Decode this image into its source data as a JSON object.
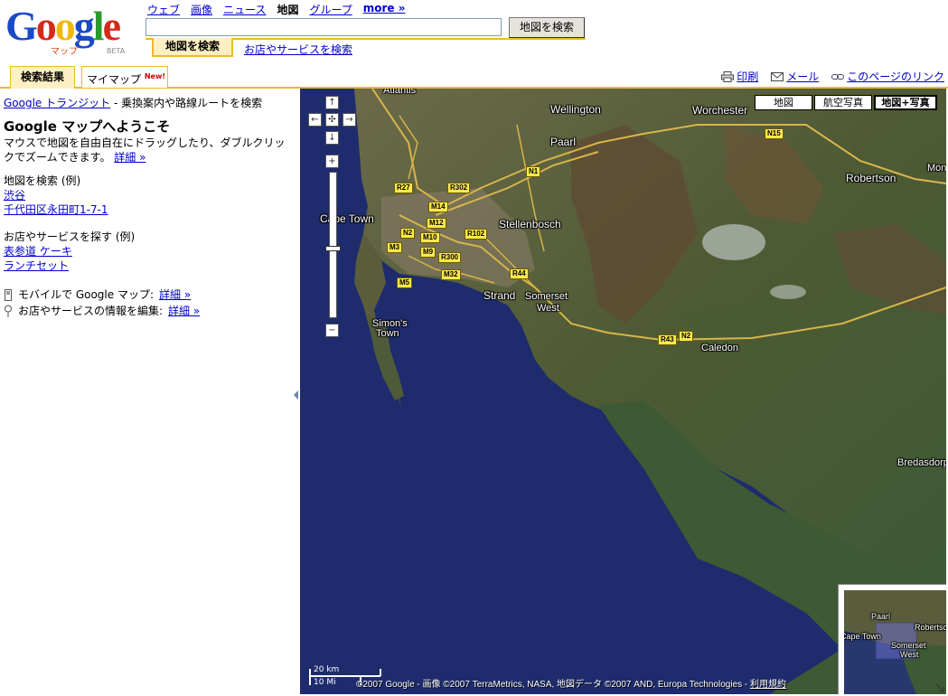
{
  "logo": {
    "text": "Google",
    "sub": "マップ",
    "beta": "BETA"
  },
  "topnav": [
    {
      "label": "ウェブ"
    },
    {
      "label": "画像"
    },
    {
      "label": "ニュース"
    },
    {
      "label": "地図",
      "selected": true
    },
    {
      "label": "グループ"
    },
    {
      "label": "more »"
    }
  ],
  "search": {
    "value": "",
    "button": "地図を検索",
    "tab_map": "地図を検索",
    "tab_business": "お店やサービスを検索"
  },
  "panel_tabs": {
    "results": "検索結果",
    "mymaps": "マイマップ",
    "new_badge": "New!"
  },
  "page_links": {
    "print": "印刷",
    "mail": "メール",
    "link": "このページのリンク"
  },
  "left": {
    "transit_link": "Google トランジット",
    "transit_text": " - 乗換案内や路線ルートを検索",
    "welcome_title": "Google マップへようこそ",
    "welcome_text": "マウスで地図を自由自在にドラッグしたり、ダブルクリックでズームできます。",
    "more_link": "詳細 »",
    "map_search_label": "地図を検索 (例)",
    "map_examples": [
      "渋谷",
      "千代田区永田町1-7-1"
    ],
    "biz_search_label": "お店やサービスを探す (例)",
    "biz_examples": [
      "表参道 ケーキ",
      "ランチセット"
    ],
    "mobile_text": "モバイルで Google マップ:",
    "mobile_link": "詳細 »",
    "edit_text": "お店やサービスの情報を編集:",
    "edit_link": "詳細 »"
  },
  "map": {
    "types": [
      "地図",
      "航空写真",
      "地図+写真"
    ],
    "selected_type": "地図+写真",
    "places": {
      "atlantis": "Atlantis",
      "wellington": "Wellington",
      "worchester": "Worchester",
      "paarl": "Paarl",
      "robertson": "Robertson",
      "mon": "Mon",
      "cape_town": "Cape Town",
      "stellenbosch": "Stellenbosch",
      "strand": "Strand",
      "somerset": "Somerset",
      "west": "West",
      "simons": "Simon's",
      "town": "Town",
      "caledon": "Caledon",
      "bredasdorp": "Bredasdorp"
    },
    "shields": [
      "N15",
      "N1",
      "R27",
      "R302",
      "M14",
      "M12",
      "N2",
      "M10",
      "R102",
      "M3",
      "M9",
      "R300",
      "R44",
      "M32",
      "M5",
      "R43",
      "N2"
    ],
    "scale_km": "20 km",
    "scale_mi": "10 Mi",
    "copyright": "©2007 Google - 画像 ©2007 TerraMetrics, NASA, 地図データ ©2007 AND, Europa Technologies - ",
    "terms": "利用規約",
    "overview": {
      "paarl": "Paarl",
      "robertson": "Robertson",
      "cape_town": "Cape Town",
      "somerset": "Somerset",
      "west": "West"
    }
  },
  "colors": {
    "accent": "#f1b72c",
    "link": "#0000cc",
    "ocean": "#1c2a6b"
  }
}
